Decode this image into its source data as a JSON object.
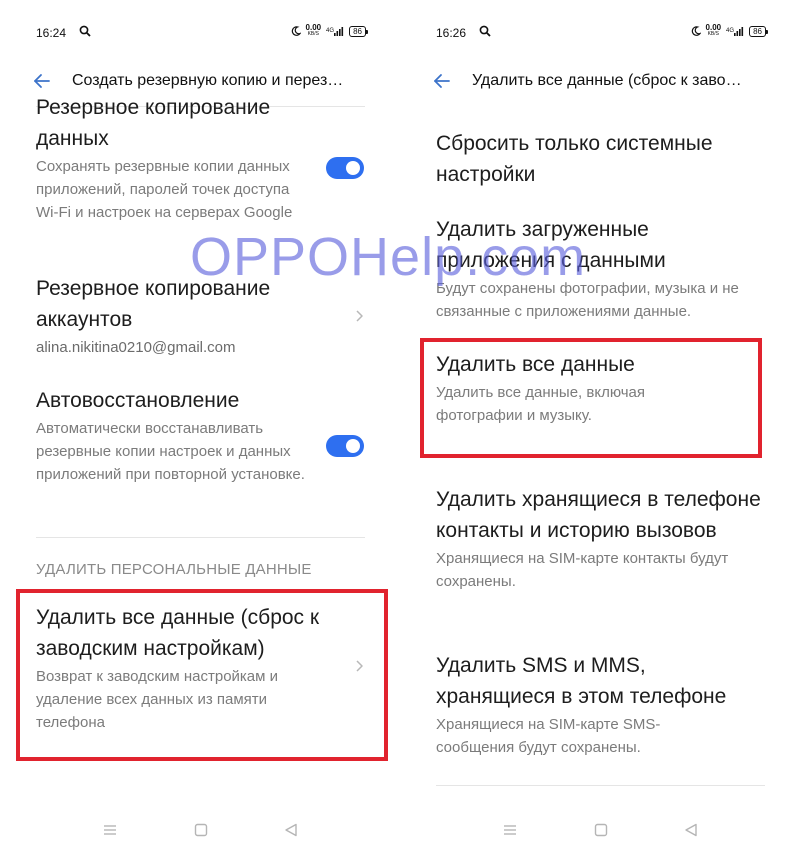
{
  "left_screen": {
    "status": {
      "time": "16:24",
      "net_value": "0.00",
      "net_unit": "KB/S",
      "network": "4G",
      "battery": "86"
    },
    "header": {
      "title": "Создать резервную копию и перез…"
    },
    "items": [
      {
        "title": "Резервное копирование данных",
        "subtitle": "Сохранять резервные копии данных приложений, паролей точек доступа Wi-Fi и настроек на серверах Google",
        "toggle_on": true
      },
      {
        "title": "Резервное копирование аккаунтов",
        "account": "alina.nikitina0210@gmail.com"
      },
      {
        "title": "Автовосстановление",
        "subtitle": "Автоматически восстанавливать резервные копии настроек и данных приложений при повторной установке.",
        "toggle_on": true
      }
    ],
    "section_header": "УДАЛИТЬ ПЕРСОНАЛЬНЫЕ ДАННЫЕ",
    "reset": {
      "title": "Удалить все данные (сброс к заводским настройкам)",
      "subtitle": "Возврат к заводским настройкам и удаление всех данных из памяти телефона"
    }
  },
  "right_screen": {
    "status": {
      "time": "16:26",
      "net_value": "0.00",
      "net_unit": "KB/S",
      "network": "4G",
      "battery": "86"
    },
    "header": {
      "title": "Удалить все данные (сброс к заво…"
    },
    "items": [
      {
        "title": "Сбросить только системные настройки"
      },
      {
        "title": "Удалить загруженные приложения с данными",
        "subtitle": "Будут сохранены фотографии, музыка и не связанные с приложениями данные."
      },
      {
        "title": "Удалить все данные",
        "subtitle": "Удалить все данные, включая фотографии и музыку."
      },
      {
        "title": "Удалить хранящиеся в телефоне контакты и историю вызовов",
        "subtitle": "Хранящиеся на SIM-карте контакты будут сохранены."
      },
      {
        "title": "Удалить SMS и MMS, хранящиеся в этом телефоне",
        "subtitle": "Хранящиеся на SIM-карте SMS-сообщения будут сохранены."
      }
    ]
  },
  "watermark": "OPPOHelp.com",
  "colors": {
    "accent": "#2e6ff0",
    "highlight": "#e1232e",
    "watermark": "#5a5fdc"
  },
  "icons": {
    "back": "arrow-left-icon",
    "chevron": "chevron-right-icon",
    "search": "search-icon",
    "moon": "moon-icon",
    "signal": "signal-icon",
    "nav": [
      "menu-icon",
      "home-icon",
      "back-triangle-icon"
    ]
  }
}
